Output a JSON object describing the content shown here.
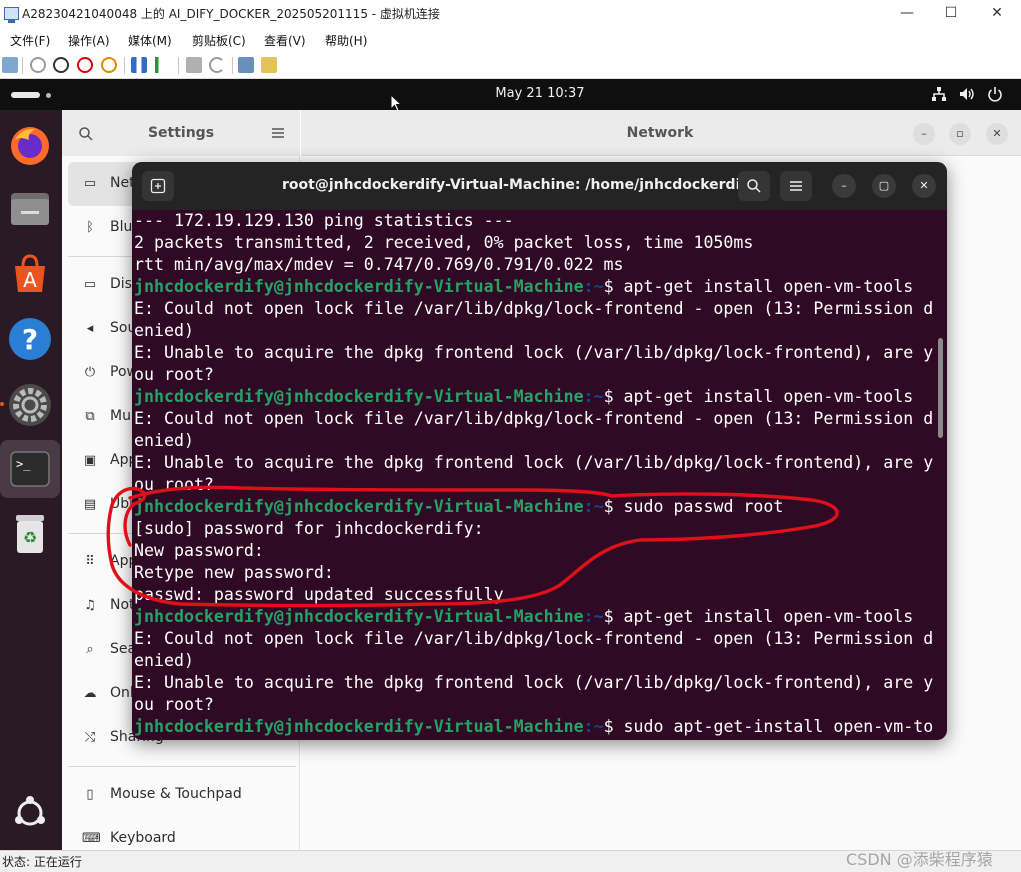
{
  "host_window": {
    "title": "A28230421040048 上的 AI_DIFY_DOCKER_202505201115 - 虚拟机连接",
    "controls": {
      "minimize": "—",
      "maximize": "☐",
      "close": "✕"
    },
    "menu": [
      "文件(F)",
      "操作(A)",
      "媒体(M)",
      "剪贴板(C)",
      "查看(V)",
      "帮助(H)"
    ],
    "status": "状态: 正在运行"
  },
  "guest_topbar": {
    "clock": "May 21  10:37"
  },
  "settings": {
    "sidebar_title": "Settings",
    "main_title": "Network",
    "sidebar_items": [
      {
        "label": "Network",
        "icon": "network-icon"
      },
      {
        "label": "Bluetooth",
        "icon": "bluetooth-icon"
      },
      {
        "label": "Displays",
        "icon": "display-icon"
      },
      {
        "label": "Sound",
        "icon": "sound-icon"
      },
      {
        "label": "Power",
        "icon": "power-icon"
      },
      {
        "label": "Multitasking",
        "icon": "multitasking-icon"
      },
      {
        "label": "Appearance",
        "icon": "appearance-icon"
      },
      {
        "label": "Ubuntu Desktop",
        "icon": "ubuntu-desktop-icon"
      },
      {
        "label": "Apps",
        "icon": "apps-icon"
      },
      {
        "label": "Notifications",
        "icon": "notifications-icon"
      },
      {
        "label": "Search",
        "icon": "search-icon"
      },
      {
        "label": "Online Accounts",
        "icon": "online-accounts-icon"
      },
      {
        "label": "Sharing",
        "icon": "sharing-icon"
      },
      {
        "label": "Mouse & Touchpad",
        "icon": "mouse-icon"
      },
      {
        "label": "Keyboard",
        "icon": "keyboard-icon"
      }
    ]
  },
  "terminal": {
    "title": "root@jnhcdockerdify-Virtual-Machine: /home/jnhcdockerdify",
    "prompt_user": "jnhcdockerdify@jnhcdockerdify-Virtual-Machine",
    "prompt_path": ":~",
    "lines": [
      {
        "type": "out",
        "text": "--- 172.19.129.130 ping statistics ---"
      },
      {
        "type": "out",
        "text": "2 packets transmitted, 2 received, 0% packet loss, time 1050ms"
      },
      {
        "type": "out",
        "text": "rtt min/avg/max/mdev = 0.747/0.769/0.791/0.022 ms"
      },
      {
        "type": "cmd",
        "text": "$ apt-get install open-vm-tools"
      },
      {
        "type": "out",
        "text": "E: Could not open lock file /var/lib/dpkg/lock-frontend - open (13: Permission d"
      },
      {
        "type": "out",
        "text": "enied)"
      },
      {
        "type": "out",
        "text": "E: Unable to acquire the dpkg frontend lock (/var/lib/dpkg/lock-frontend), are y"
      },
      {
        "type": "out",
        "text": "ou root?"
      },
      {
        "type": "cmd",
        "text": "$ apt-get install open-vm-tools"
      },
      {
        "type": "out",
        "text": "E: Could not open lock file /var/lib/dpkg/lock-frontend - open (13: Permission d"
      },
      {
        "type": "out",
        "text": "enied)"
      },
      {
        "type": "out",
        "text": "E: Unable to acquire the dpkg frontend lock (/var/lib/dpkg/lock-frontend), are y"
      },
      {
        "type": "out",
        "text": "ou root?"
      },
      {
        "type": "cmd",
        "text": "$ sudo passwd root"
      },
      {
        "type": "out",
        "text": "[sudo] password for jnhcdockerdify:"
      },
      {
        "type": "out",
        "text": "New password:"
      },
      {
        "type": "out",
        "text": "Retype new password:"
      },
      {
        "type": "out",
        "text": "passwd: password updated successfully"
      },
      {
        "type": "cmd",
        "text": "$ apt-get install open-vm-tools"
      },
      {
        "type": "out",
        "text": "E: Could not open lock file /var/lib/dpkg/lock-frontend - open (13: Permission d"
      },
      {
        "type": "out",
        "text": "enied)"
      },
      {
        "type": "out",
        "text": "E: Unable to acquire the dpkg frontend lock (/var/lib/dpkg/lock-frontend), are y"
      },
      {
        "type": "out",
        "text": "ou root?"
      },
      {
        "type": "cmd",
        "text": "$ sudo apt-get-install open-vm-to"
      }
    ]
  },
  "watermark": "CSDN @添柴程序猿",
  "colors": {
    "terminal_bg": "#300a24",
    "prompt_user": "#26a269",
    "prompt_path": "#12488b",
    "annotation": "#e0101a",
    "dock_bg": "#2a1a25"
  }
}
